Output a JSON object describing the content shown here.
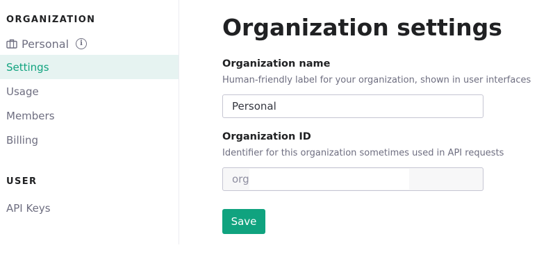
{
  "sidebar": {
    "organization_heading": "ORGANIZATION",
    "org_name": "Personal",
    "org_icon": "briefcase-icon",
    "info_icon": "info-icon",
    "items": [
      {
        "label": "Settings",
        "active": true
      },
      {
        "label": "Usage",
        "active": false
      },
      {
        "label": "Members",
        "active": false
      },
      {
        "label": "Billing",
        "active": false
      }
    ],
    "user_heading": "USER",
    "user_items": [
      {
        "label": "API Keys",
        "active": false
      }
    ]
  },
  "main": {
    "title": "Organization settings",
    "org_name_field": {
      "label": "Organization name",
      "help": "Human-friendly label for your organization, shown in user interfaces",
      "value": "Personal"
    },
    "org_id_field": {
      "label": "Organization ID",
      "help": "Identifier for this organization sometimes used in API requests",
      "value": "org"
    },
    "save_label": "Save"
  },
  "colors": {
    "accent": "#10a37f",
    "active_bg": "#e6f3f1",
    "muted_text": "#6e6e80"
  }
}
